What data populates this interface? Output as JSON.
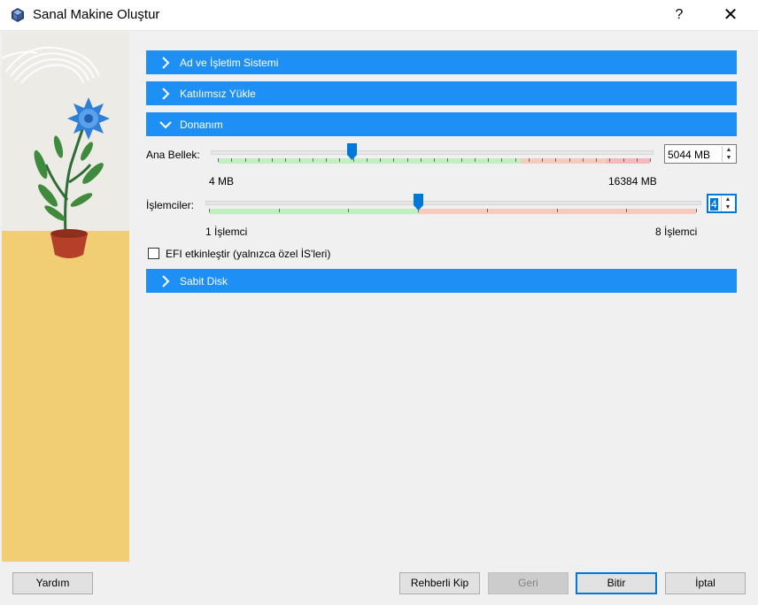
{
  "window": {
    "title": "Sanal Makine Oluştur",
    "help_glyph": "?",
    "close_glyph": "✕"
  },
  "sections": {
    "name_os": "Ad ve İşletim Sistemi",
    "unattended": "Katılımsız Yükle",
    "hardware": "Donanım",
    "hard_disk": "Sabit Disk"
  },
  "hardware": {
    "memory": {
      "label": "Ana Bellek:",
      "value": "5044 MB",
      "min_label": "4 MB",
      "max_label": "16384 MB",
      "fraction": 0.31,
      "ok_fraction": 0.5,
      "warn_fraction": 0.75
    },
    "processors": {
      "label": "İşlemciler:",
      "value": "4",
      "min_label": "1 İşlemci",
      "max_label": "8 İşlemci",
      "fraction": 0.43,
      "ok_fraction": 0.43
    },
    "efi": {
      "label": "EFI etkinleştir (yalnızca özel İS'leri)",
      "checked": false
    }
  },
  "buttons": {
    "help": "Yardım",
    "guided_mode": "Rehberli Kip",
    "back": "Geri",
    "finish": "Bitir",
    "cancel": "İptal"
  },
  "colors": {
    "section_header": "#1e90f5",
    "slider_ok": "#c2efc2",
    "slider_warn": "#f5cbbd",
    "slider_bad": "#f4b8bd",
    "accent": "#0078d7"
  },
  "icons": {
    "app": "virtualbox-icon",
    "expand": "chevron-right-icon",
    "collapse": "chevron-down-icon",
    "spin_up": "caret-up-icon",
    "spin_down": "caret-down-icon"
  }
}
